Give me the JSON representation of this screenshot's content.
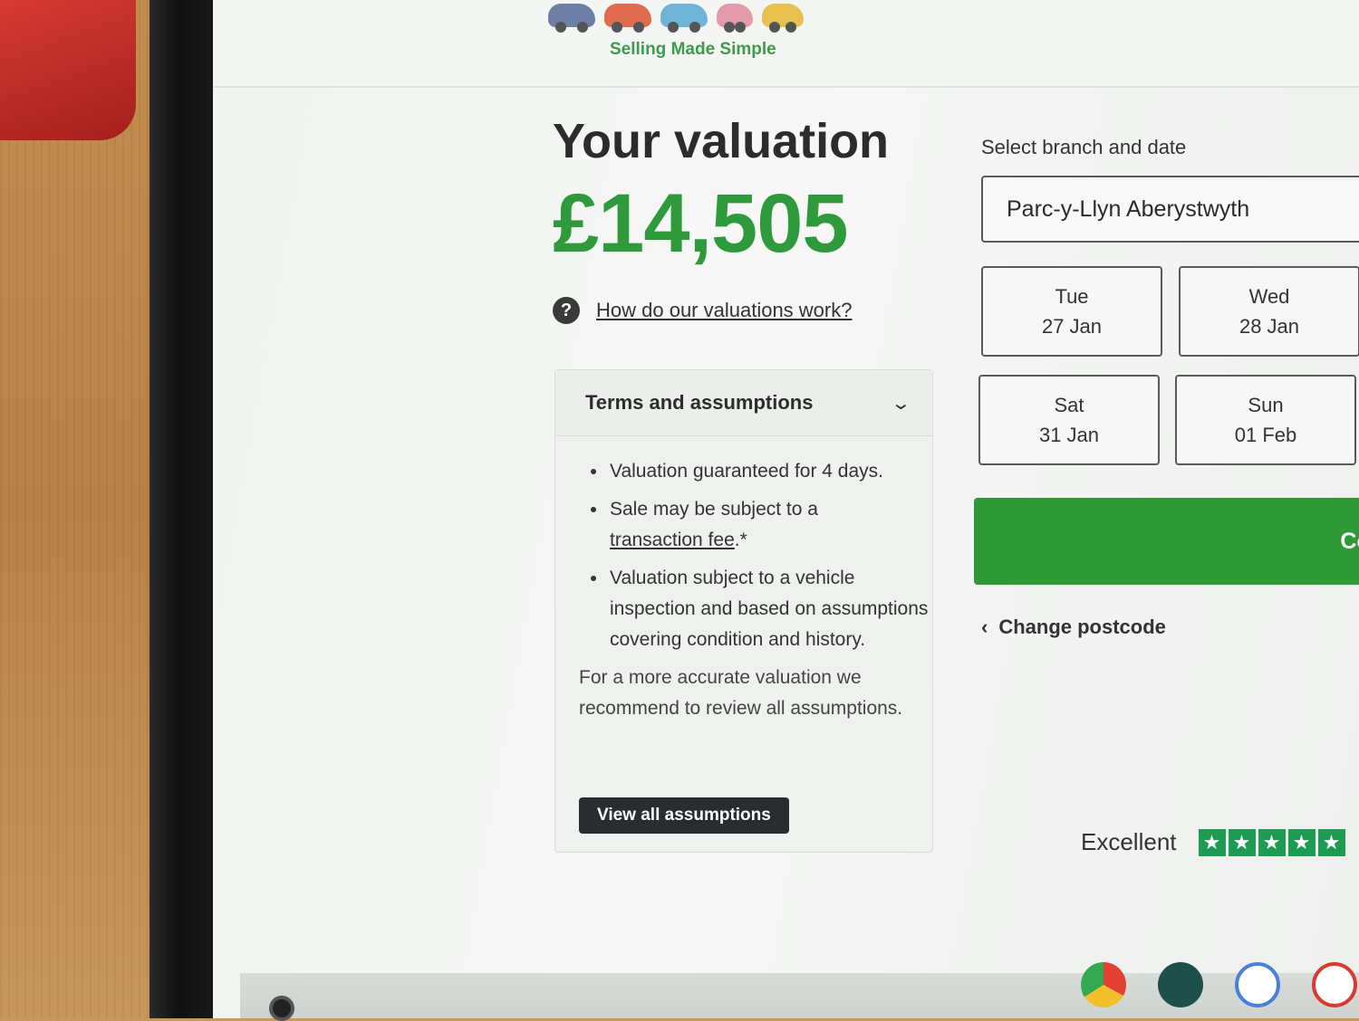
{
  "header": {
    "tagline": "Selling Made Simple"
  },
  "valuation": {
    "title": "Your valuation",
    "amount": "£14,505",
    "help_link": "How do our valuations work?"
  },
  "terms": {
    "title": "Terms and assumptions",
    "items": [
      "Valuation guaranteed for 4 days.",
      "Sale may be subject to a",
      "transaction fee",
      ".*",
      "Valuation subject to a vehicle inspection and based on assumptions covering condition and history."
    ],
    "advice": "For a more accurate valuation we recommend to review all assumptions.",
    "view_button": "View all assumptions"
  },
  "booking": {
    "label": "Select branch and date",
    "branch": "Parc-y-Llyn Aberystwyth",
    "dates": [
      {
        "day": "Tue",
        "date": "27 Jan"
      },
      {
        "day": "Wed",
        "date": "28 Jan"
      },
      {
        "day": "Sat",
        "date": "31 Jan"
      },
      {
        "day": "Sun",
        "date": "01 Feb"
      }
    ],
    "continue": "Contir",
    "change_postcode": "Change postcode"
  },
  "rating": {
    "label": "Excellent",
    "stars": 5
  },
  "colors": {
    "brand_green": "#2f9a3c",
    "button_dark": "#2a2d30",
    "trust_green": "#1e9c53"
  },
  "taskbar": {
    "apps": [
      "chrome-icon",
      "apps-icon",
      "calendar-icon",
      "gmail-icon"
    ]
  }
}
